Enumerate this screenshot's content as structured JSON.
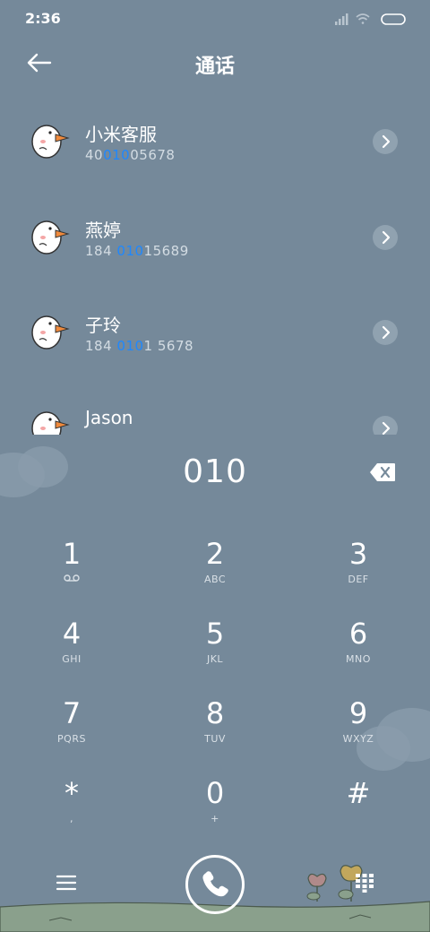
{
  "status_bar": {
    "time": "2:36"
  },
  "header": {
    "title": "通话"
  },
  "contacts": [
    {
      "name": "小米客服",
      "number_before": "40",
      "number_match": "010",
      "number_after": "05678"
    },
    {
      "name": "燕婷",
      "number_before": "184 ",
      "number_match": "010",
      "number_after": "15689"
    },
    {
      "name": "子玲",
      "number_before": "184 ",
      "number_match": "010",
      "number_after": "1 5678"
    },
    {
      "name": "Jason",
      "number_before": "",
      "number_match": "",
      "number_after": ""
    }
  ],
  "dial_entry": {
    "value": "010"
  },
  "keypad": [
    {
      "digit": "1",
      "sub": ""
    },
    {
      "digit": "2",
      "sub": "ABC"
    },
    {
      "digit": "3",
      "sub": "DEF"
    },
    {
      "digit": "4",
      "sub": "GHI"
    },
    {
      "digit": "5",
      "sub": "JKL"
    },
    {
      "digit": "6",
      "sub": "MNO"
    },
    {
      "digit": "7",
      "sub": "PQRS"
    },
    {
      "digit": "8",
      "sub": "TUV"
    },
    {
      "digit": "9",
      "sub": "WXYZ"
    },
    {
      "digit": "*",
      "sub": ","
    },
    {
      "digit": "0",
      "sub": "+"
    },
    {
      "digit": "#",
      "sub": ""
    }
  ],
  "colors": {
    "background": "#75899a",
    "match_highlight": "#1e88ff",
    "text": "#ffffff"
  },
  "icons": {
    "back": "arrow-left-icon",
    "detail": "chevron-right-icon",
    "backspace": "backspace-icon",
    "voicemail": "voicemail-icon",
    "menu": "hamburger-menu-icon",
    "call": "phone-icon",
    "keypad": "dialpad-icon"
  }
}
